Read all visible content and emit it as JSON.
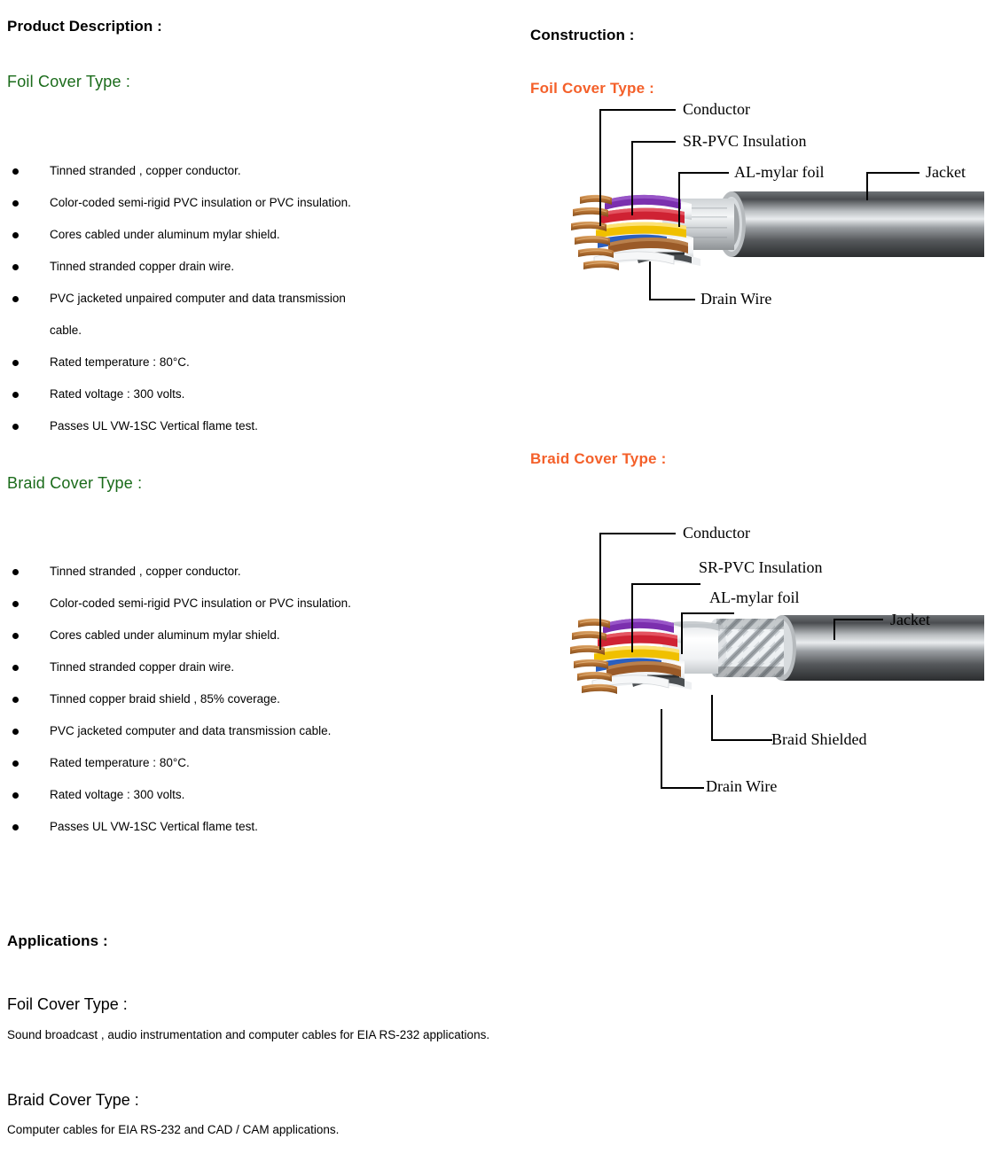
{
  "left_column": {
    "product_description_heading": "Product Description :",
    "foil_heading": "Foil Cover Type :",
    "foil_bullets": [
      "Tinned stranded , copper conductor.",
      "Color-coded semi-rigid PVC insulation or PVC insulation.",
      "Cores cabled under aluminum mylar shield.",
      "Tinned stranded copper drain wire.",
      "PVC jacketed unpaired computer and data transmission",
      "cable.",
      "Rated temperature : 80°C.",
      "Rated voltage : 300 volts.",
      "Passes UL VW-1SC Vertical flame test."
    ],
    "braid_heading": "Braid Cover Type :",
    "braid_bullets": [
      "Tinned stranded , copper conductor.",
      "Color-coded semi-rigid PVC insulation or PVC insulation.",
      "Cores cabled under aluminum mylar shield.",
      "Tinned stranded copper drain wire.",
      "Tinned copper braid shield , 85% coverage.",
      "PVC jacketed computer and data transmission cable.",
      "Rated temperature : 80°C.",
      "Rated voltage : 300 volts.",
      "Passes UL VW-1SC Vertical flame test."
    ]
  },
  "right_column": {
    "construction_heading": "Construction :",
    "foil_heading": "Foil Cover Type :",
    "foil_labels": {
      "conductor": "Conductor",
      "sr_pvc": "SR-PVC Insulation",
      "al_mylar": "AL-mylar foil",
      "jacket": "Jacket",
      "drain_wire": "Drain Wire"
    },
    "braid_heading": "Braid Cover Type :",
    "braid_labels": {
      "conductor": "Conductor",
      "sr_pvc": "SR-PVC Insulation",
      "al_mylar": "AL-mylar foil",
      "jacket": "Jacket",
      "braid_shielded": "Braid Shielded",
      "drain_wire": "Drain Wire"
    }
  },
  "applications": {
    "heading": "Applications :",
    "foil_heading": "Foil Cover Type :",
    "foil_text": "Sound broadcast , audio instrumentation and computer cables for EIA RS-232 applications.",
    "braid_heading": "Braid Cover Type :",
    "braid_text": "Computer cables for EIA RS-232 and CAD / CAM applications."
  },
  "colors": {
    "green_heading": "#1a6b1a",
    "orange_heading": "#f4602a",
    "text": "#000000",
    "jacket_dark": "#3a3c3e",
    "jacket_light": "#e8eaec",
    "conductor_copper": "#c08040"
  },
  "conductor_colors": [
    "#7b2fae",
    "#d02030",
    "#f0c000",
    "#2a5fc0",
    "#9a5a28",
    "#f2f2f2"
  ]
}
